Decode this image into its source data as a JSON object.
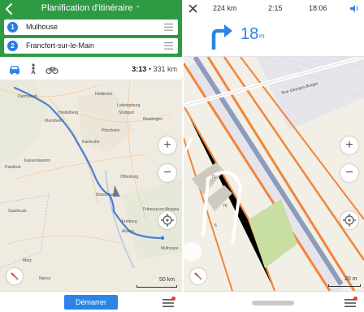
{
  "left": {
    "header": {
      "title": "Planification d'itinéraire",
      "title_caret": "⌃"
    },
    "route": {
      "origin": {
        "index": "1",
        "value": "Mulhouse"
      },
      "destination": {
        "index": "2",
        "value": "Francfort-sur-le-Main"
      }
    },
    "modes": {
      "items": [
        "car-icon",
        "pedestrian-icon",
        "bicycle-icon"
      ],
      "selected": "car"
    },
    "summary": {
      "duration": "3:13",
      "separator": "•",
      "distance": "331 km"
    },
    "map": {
      "cities": [
        {
          "name": "Darmstadt"
        },
        {
          "name": "Mannheim"
        },
        {
          "name": "Heidelberg"
        },
        {
          "name": "Heilbronn"
        },
        {
          "name": "Ludwigsburg"
        },
        {
          "name": "Stuttgart"
        },
        {
          "name": "Karlsruhe"
        },
        {
          "name": "Pforzheim"
        },
        {
          "name": "Reutlingen"
        },
        {
          "name": "Kaiserslautern"
        },
        {
          "name": "Palatinat"
        },
        {
          "name": "Saarbruck"
        },
        {
          "name": "Strasbourg"
        },
        {
          "name": "Freiburg"
        },
        {
          "name": "Offenburg"
        },
        {
          "name": "Alsace"
        },
        {
          "name": "Metz"
        },
        {
          "name": "Nancy"
        },
        {
          "name": "Fribourg-en-Brisgau"
        },
        {
          "name": "Mulhouse"
        }
      ],
      "scale_label": "50 km",
      "zoom_in": "+",
      "zoom_out": "−"
    },
    "footer": {
      "start_label": "Démarrer"
    }
  },
  "right": {
    "status": {
      "remaining_distance": "224 km",
      "remaining_time": "2:15",
      "eta": "18:06"
    },
    "instruction": {
      "distance_value": "18",
      "distance_unit": "m"
    },
    "map": {
      "street_name": "Rue Georges Burger",
      "building_numbers": [
        "71",
        "70",
        "6"
      ],
      "scale_label": "20 m",
      "zoom_in": "+",
      "zoom_out": "−"
    }
  },
  "colors": {
    "header_green": "#2f9a44",
    "accent_blue": "#2a85e6",
    "route_line": "#4a7fd4",
    "motorway": "#f08a3c",
    "notification_red": "#e63b2e"
  }
}
